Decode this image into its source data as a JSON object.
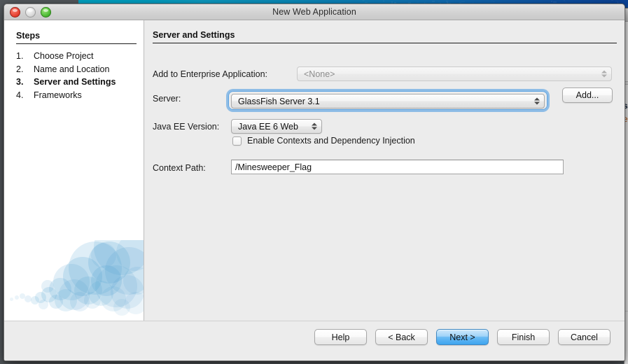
{
  "window": {
    "title": "New Web Application",
    "traffic_lights": [
      {
        "name": "close-button",
        "color": "#e5402f"
      },
      {
        "name": "minimize-button",
        "color": "#d6d6d6"
      },
      {
        "name": "zoom-button",
        "color": "#49b831"
      }
    ]
  },
  "sidebar": {
    "heading": "Steps",
    "steps": [
      {
        "num": "1.",
        "label": "Choose Project",
        "current": false
      },
      {
        "num": "2.",
        "label": "Name and Location",
        "current": false
      },
      {
        "num": "3.",
        "label": "Server and Settings",
        "current": true
      },
      {
        "num": "4.",
        "label": "Frameworks",
        "current": false
      }
    ]
  },
  "main": {
    "heading": "Server and Settings",
    "fields": {
      "enterprise_app": {
        "label": "Add to Enterprise Application:",
        "value": "<None>",
        "disabled": true
      },
      "server": {
        "label": "Server:",
        "value": "GlassFish Server 3.1",
        "focused": true
      },
      "add_button": {
        "label": "Add..."
      },
      "java_ee_version": {
        "label": "Java EE Version:",
        "value": "Java EE 6 Web"
      },
      "cdi": {
        "label": "Enable Contexts and Dependency Injection",
        "checked": false
      },
      "context_path": {
        "label": "Context Path:",
        "value": "/Minesweeper_Flag"
      }
    }
  },
  "footer": {
    "buttons": [
      {
        "label": "Help",
        "default": false
      },
      {
        "label": "< Back",
        "default": false
      },
      {
        "label": "Next >",
        "default": true
      },
      {
        "label": "Finish",
        "default": false
      },
      {
        "label": "Cancel",
        "default": false
      }
    ]
  },
  "background": {
    "window_text_line1": "s",
    "window_text_line2": "e"
  },
  "colors": {
    "accent": "#3ea4ef",
    "focus_ring": "#56a0e2",
    "dialog_bg": "#ececec",
    "sidebar_bg": "#ffffff",
    "bubble": "#4d9ed0"
  }
}
